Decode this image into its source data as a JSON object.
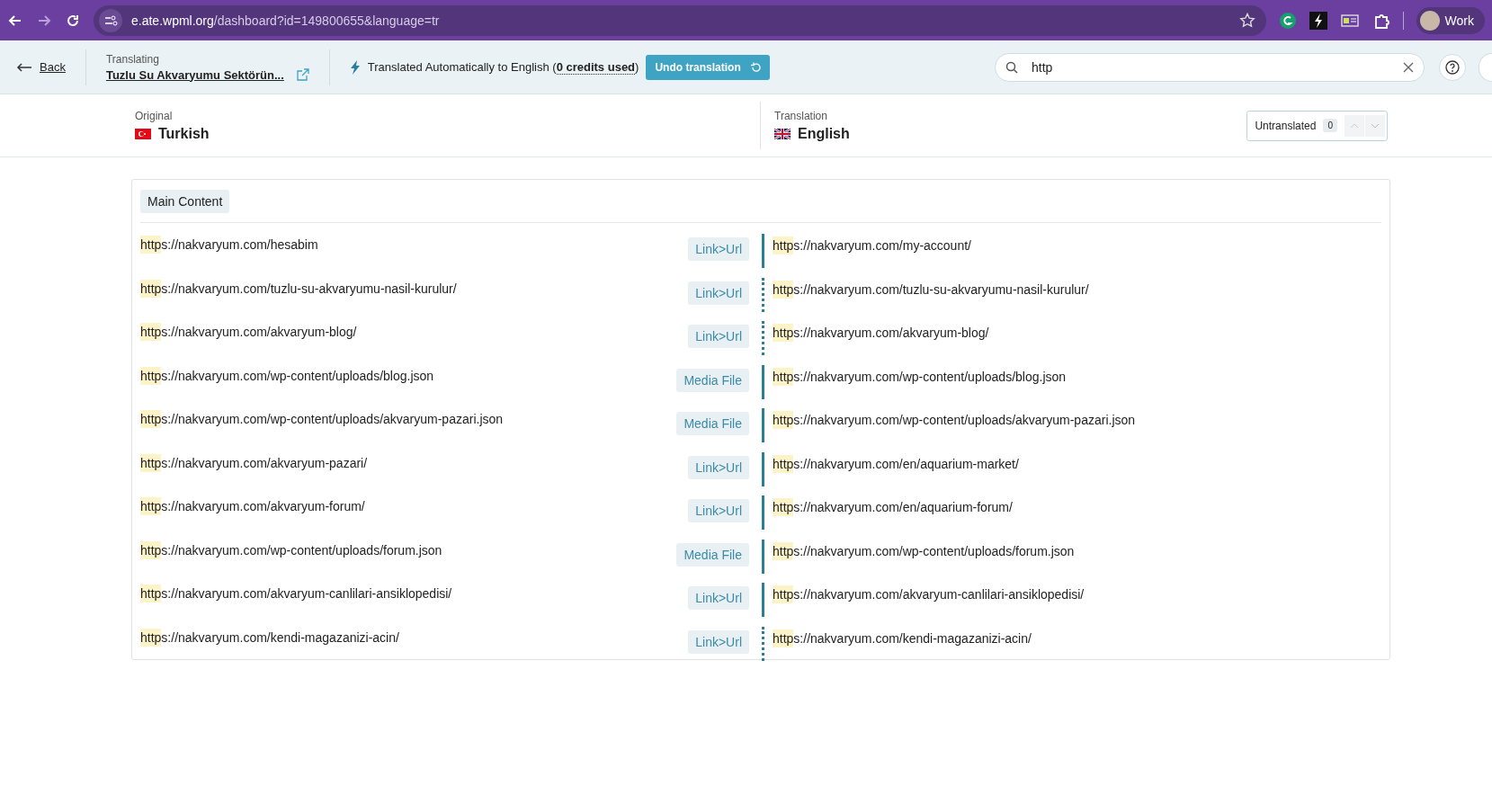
{
  "browser": {
    "url_host": "e.ate.wpml.org",
    "url_path": "/dashboard?id=149800655&language=tr",
    "profile": "Work"
  },
  "header": {
    "back": "Back",
    "translating_label": "Translating",
    "document_title": "Tuzlu Su Akvaryumu Sektörün...",
    "status_prefix": "Translated Automatically to English (",
    "credits": "0 credits used",
    "status_suffix": ")",
    "undo_button": "Undo translation",
    "search": {
      "value": "http"
    }
  },
  "languages": {
    "original_label": "Original",
    "original": "Turkish",
    "translation_label": "Translation",
    "translation": "English",
    "filter": {
      "label": "Untranslated",
      "count": "0"
    }
  },
  "section": {
    "title": "Main Content"
  },
  "segments": [
    {
      "source": {
        "match": "http",
        "rest": "s://nakvaryum.com/hesabim"
      },
      "type": "Link>Url",
      "reviewed": true,
      "target": {
        "match": "http",
        "rest": "s://nakvaryum.com/my-account/"
      }
    },
    {
      "source": {
        "match": "http",
        "rest": "s://nakvaryum.com/tuzlu-su-akvaryumu-nasil-kurulur/"
      },
      "type": "Link>Url",
      "reviewed": false,
      "target": {
        "match": "http",
        "rest": "s://nakvaryum.com/tuzlu-su-akvaryumu-nasil-kurulur/"
      }
    },
    {
      "source": {
        "match": "http",
        "rest": "s://nakvaryum.com/akvaryum-blog/"
      },
      "type": "Link>Url",
      "reviewed": false,
      "target": {
        "match": "http",
        "rest": "s://nakvaryum.com/akvaryum-blog/"
      }
    },
    {
      "source": {
        "match": "http",
        "rest": "s://nakvaryum.com/wp-content/uploads/blog.json"
      },
      "type": "Media File",
      "reviewed": true,
      "target": {
        "match": "http",
        "rest": "s://nakvaryum.com/wp-content/uploads/blog.json"
      }
    },
    {
      "source": {
        "match": "http",
        "rest": "s://nakvaryum.com/wp-content/uploads/akvaryum-pazari.json"
      },
      "type": "Media File",
      "reviewed": true,
      "target": {
        "match": "http",
        "rest": "s://nakvaryum.com/wp-content/uploads/akvaryum-pazari.json"
      }
    },
    {
      "source": {
        "match": "http",
        "rest": "s://nakvaryum.com/akvaryum-pazari/"
      },
      "type": "Link>Url",
      "reviewed": true,
      "target": {
        "match": "http",
        "rest": "s://nakvaryum.com/en/aquarium-market/"
      }
    },
    {
      "source": {
        "match": "http",
        "rest": "s://nakvaryum.com/akvaryum-forum/"
      },
      "type": "Link>Url",
      "reviewed": true,
      "target": {
        "match": "http",
        "rest": "s://nakvaryum.com/en/aquarium-forum/"
      }
    },
    {
      "source": {
        "match": "http",
        "rest": "s://nakvaryum.com/wp-content/uploads/forum.json"
      },
      "type": "Media File",
      "reviewed": true,
      "target": {
        "match": "http",
        "rest": "s://nakvaryum.com/wp-content/uploads/forum.json"
      }
    },
    {
      "source": {
        "match": "http",
        "rest": "s://nakvaryum.com/akvaryum-canlilari-ansiklopedisi/"
      },
      "type": "Link>Url",
      "reviewed": true,
      "target": {
        "match": "http",
        "rest": "s://nakvaryum.com/akvaryum-canlilari-ansiklopedisi/"
      }
    },
    {
      "source": {
        "match": "http",
        "rest": "s://nakvaryum.com/kendi-magazanizi-acin/"
      },
      "type": "Link>Url",
      "reviewed": false,
      "target": {
        "match": "http",
        "rest": "s://nakvaryum.com/kendi-magazanizi-acin/"
      }
    }
  ]
}
